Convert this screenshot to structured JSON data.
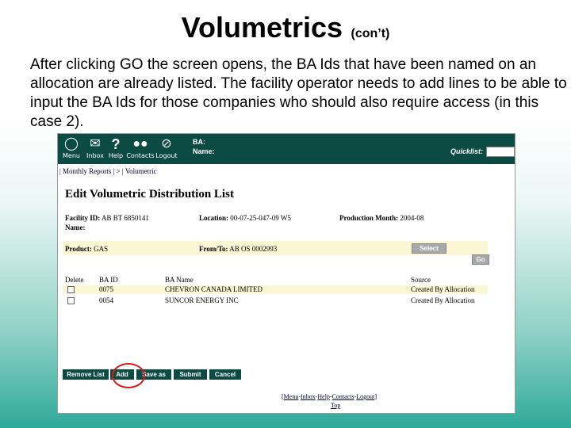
{
  "slide": {
    "title": "Volumetrics",
    "subtitle": "(con’t)",
    "body": "After clicking GO the screen opens, the BA Ids that have been named on an allocation are already listed.  The facility operator needs to add lines to be able to input the BA Ids for those companies who should also require access (in this case 2)."
  },
  "app": {
    "nav": [
      {
        "label": "Menu",
        "icon": "globe-icon"
      },
      {
        "label": "Inbox",
        "icon": "envelope-icon"
      },
      {
        "label": "Help",
        "icon": "question-icon"
      },
      {
        "label": "Contacts",
        "icon": "people-icon"
      },
      {
        "label": "Logout",
        "icon": "no-entry-icon"
      }
    ],
    "ba_label": "BA:",
    "name_label": "Name:",
    "quicklist_label": "Quicklist:",
    "quicklist_value": "",
    "breadcrumb": "| Monthly Reports | > | Volumetric",
    "page_title": "Edit Volumetric Distribution List",
    "facility_id_label": "Facility ID:",
    "facility_id_value": "AB BT 6850141",
    "name_field_label": "Name:",
    "location_label": "Location:",
    "location_value": "00-07-25-047-09 W5",
    "production_month_label": "Production Month:",
    "production_month_value": "2004-08",
    "product_label": "Product:",
    "product_value": "GAS",
    "fromto_label": "From/To:",
    "fromto_value": "AB OS 0002993",
    "select_button": "Select",
    "go_button": "Go",
    "table": {
      "headers": [
        "Delete",
        "BA ID",
        "BA Name",
        "Source"
      ],
      "rows": [
        {
          "ba_id": "0075",
          "ba_name": "CHEVRON CANADA LIMITED",
          "source": "Created By Allocation"
        },
        {
          "ba_id": "0054",
          "ba_name": "SUNCOR ENERGY INC",
          "source": "Created By Allocation"
        }
      ]
    },
    "actions": {
      "remove": "Remove List",
      "add": "Add",
      "save_as": "Save as",
      "submit": "Submit",
      "cancel": "Cancel"
    },
    "footer": {
      "links": [
        "Menu",
        "Inbox",
        "Help",
        "Contacts",
        "Logout"
      ],
      "top": "Top"
    }
  },
  "colors": {
    "topbar": "#0c4a44",
    "highlight_row": "#fbf7d5",
    "annotation_circle": "#d61a1a"
  }
}
